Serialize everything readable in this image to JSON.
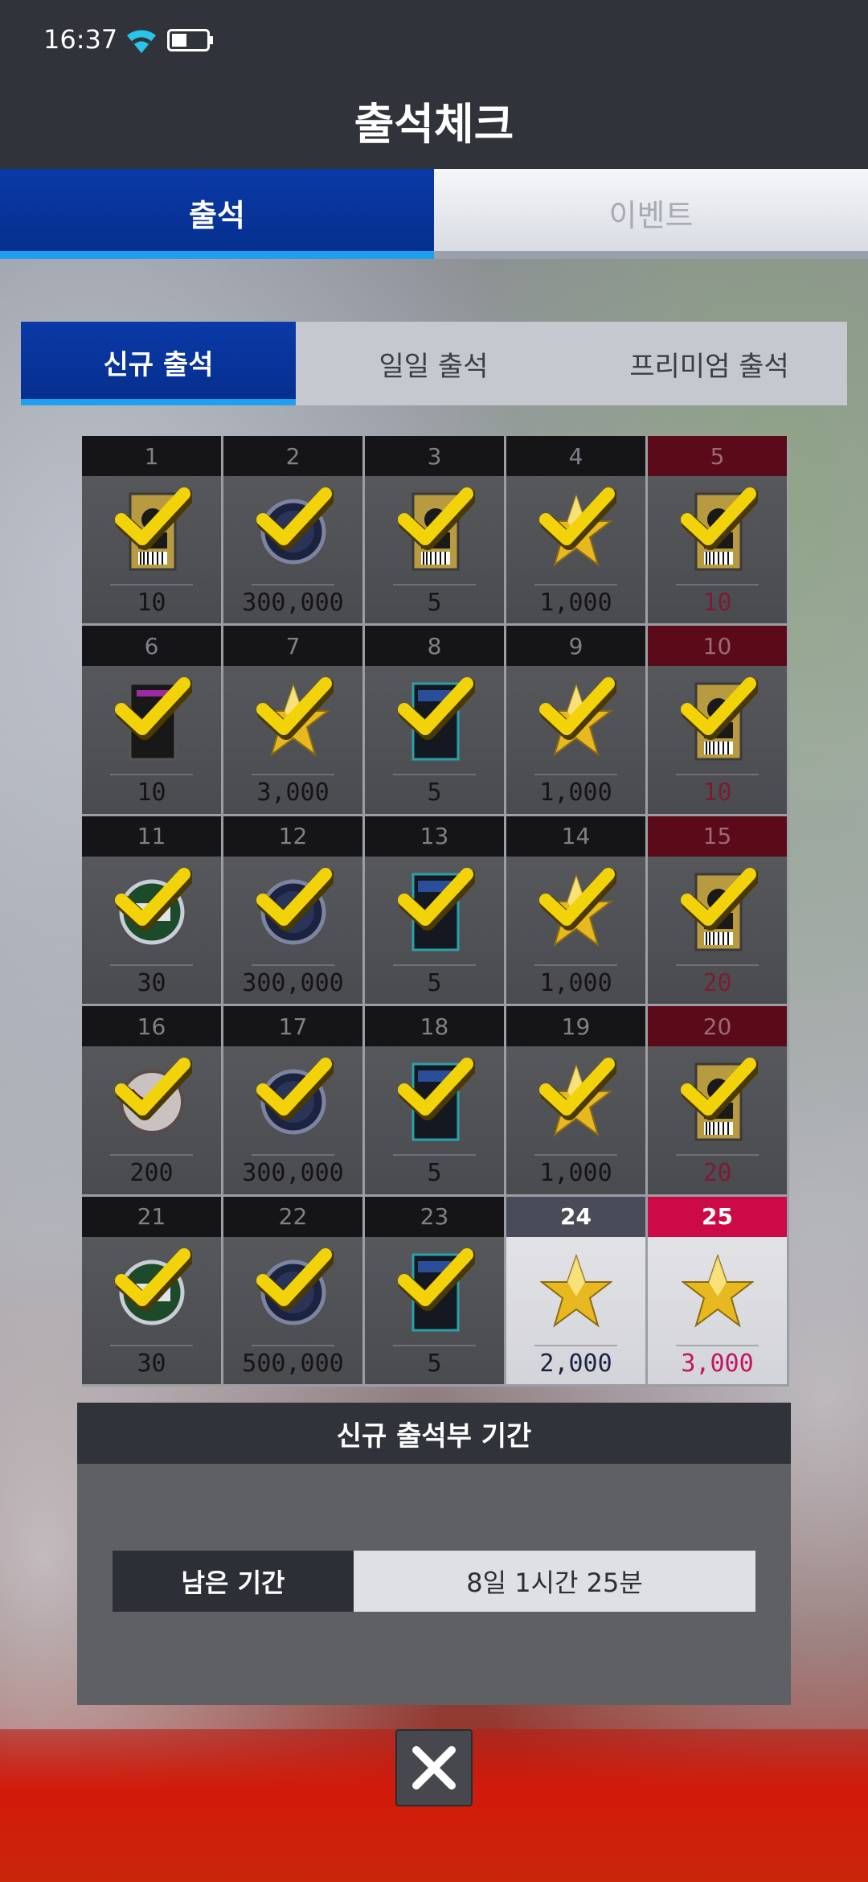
{
  "status_bar": {
    "time": "16:37"
  },
  "header": {
    "title": "출석체크"
  },
  "main_tabs": [
    {
      "label": "출석",
      "active": true
    },
    {
      "label": "이벤트",
      "active": false
    }
  ],
  "sub_tabs": [
    {
      "label": "신규 출석",
      "active": true
    },
    {
      "label": "일일 출석",
      "active": false
    },
    {
      "label": "프리미엄 출석",
      "active": false
    }
  ],
  "days": [
    {
      "day": "1",
      "amount": "10",
      "item": "player-card-icon",
      "checked": true,
      "red": false
    },
    {
      "day": "2",
      "amount": "300,000",
      "item": "coin-icon",
      "checked": true,
      "red": false
    },
    {
      "day": "3",
      "amount": "5",
      "item": "player-card-icon",
      "checked": true,
      "red": false
    },
    {
      "day": "4",
      "amount": "1,000",
      "item": "star-icon",
      "checked": true,
      "red": false
    },
    {
      "day": "5",
      "amount": "10",
      "item": "player-card-icon",
      "checked": true,
      "red": true
    },
    {
      "day": "6",
      "amount": "10",
      "item": "dark-card-icon",
      "checked": true,
      "red": false
    },
    {
      "day": "7",
      "amount": "3,000",
      "item": "star-icon",
      "checked": true,
      "red": false
    },
    {
      "day": "8",
      "amount": "5",
      "item": "exp-card-icon",
      "checked": true,
      "red": false
    },
    {
      "day": "9",
      "amount": "1,000",
      "item": "star-icon",
      "checked": true,
      "red": false
    },
    {
      "day": "10",
      "amount": "10",
      "item": "player-card-icon",
      "checked": true,
      "red": true
    },
    {
      "day": "11",
      "amount": "30",
      "item": "green-ticket-icon",
      "checked": true,
      "red": false
    },
    {
      "day": "12",
      "amount": "300,000",
      "item": "coin-icon",
      "checked": true,
      "red": false
    },
    {
      "day": "13",
      "amount": "5",
      "item": "exp-card-icon",
      "checked": true,
      "red": false
    },
    {
      "day": "14",
      "amount": "1,000",
      "item": "star-icon",
      "checked": true,
      "red": false
    },
    {
      "day": "15",
      "amount": "20",
      "item": "player-card-icon",
      "checked": true,
      "red": true
    },
    {
      "day": "16",
      "amount": "200",
      "item": "ball-icon",
      "checked": true,
      "red": false
    },
    {
      "day": "17",
      "amount": "300,000",
      "item": "coin-icon",
      "checked": true,
      "red": false
    },
    {
      "day": "18",
      "amount": "5",
      "item": "exp-card-icon",
      "checked": true,
      "red": false
    },
    {
      "day": "19",
      "amount": "1,000",
      "item": "star-icon",
      "checked": true,
      "red": false
    },
    {
      "day": "20",
      "amount": "20",
      "item": "player-card-icon",
      "checked": true,
      "red": true
    },
    {
      "day": "21",
      "amount": "30",
      "item": "green-ticket-icon",
      "checked": true,
      "red": false
    },
    {
      "day": "22",
      "amount": "500,000",
      "item": "coin-icon",
      "checked": true,
      "red": false
    },
    {
      "day": "23",
      "amount": "5",
      "item": "exp-card-icon",
      "checked": true,
      "red": false
    },
    {
      "day": "24",
      "amount": "2,000",
      "item": "star-icon",
      "checked": false,
      "red": false
    },
    {
      "day": "25",
      "amount": "3,000",
      "item": "star-icon",
      "checked": false,
      "red": true
    }
  ],
  "period": {
    "title": "신규 출석부 기간",
    "remain_label": "남은 기간",
    "remain_value": "8일 1시간 25분"
  },
  "colors": {
    "accent_blue": "#0a3aa8",
    "tab_underline": "#1ea0f0",
    "red_day": "#cc0a45",
    "check_yellow": "#f2d30a"
  }
}
